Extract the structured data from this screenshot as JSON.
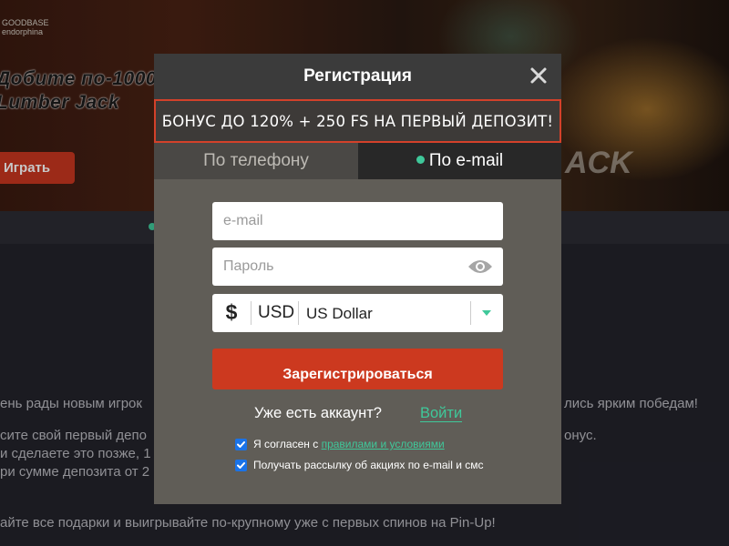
{
  "background": {
    "logo_line1": "GOODBASE",
    "logo_line2": "endorphina",
    "headline_line1": "Добите по-1000",
    "headline_line2": "Lumber Jack",
    "play_button": "Играть",
    "banner_big_text": "ACK",
    "text_lines": [
      "ень рады новым игрок",
      "лись ярким победам!",
      "сите свой первый депо",
      "онус.",
      "и сделаете это позже, 1",
      "ри сумме депозита от 2",
      "айте все подарки и выигрывайте по-крупному уже с первых спинов на Pin-Up!"
    ]
  },
  "modal": {
    "title": "Регистрация",
    "promo": "БОНУС ДО 120% + 250 FS НА ПЕРВЫЙ ДЕПОЗИТ!",
    "tabs": [
      {
        "label": "По телефону",
        "active": false
      },
      {
        "label": "По e-mail",
        "active": true
      }
    ],
    "email_placeholder": "e-mail",
    "password_placeholder": "Пароль",
    "currency": {
      "symbol": "$",
      "code": "USD",
      "name": "US Dollar"
    },
    "register_label": "Зарегистрироваться",
    "have_account": "Уже есть аккаунт?",
    "login_label": "Войти",
    "consent_terms_prefix": "Я согласен с ",
    "consent_terms_link": "правилами и условиями",
    "consent_newsletter": "Получать рассылку об акциях по e-mail и смс"
  },
  "colors": {
    "accent_green": "#3fc89a",
    "brand_red": "#cc391f",
    "checkbox_blue": "#1a73e8"
  }
}
